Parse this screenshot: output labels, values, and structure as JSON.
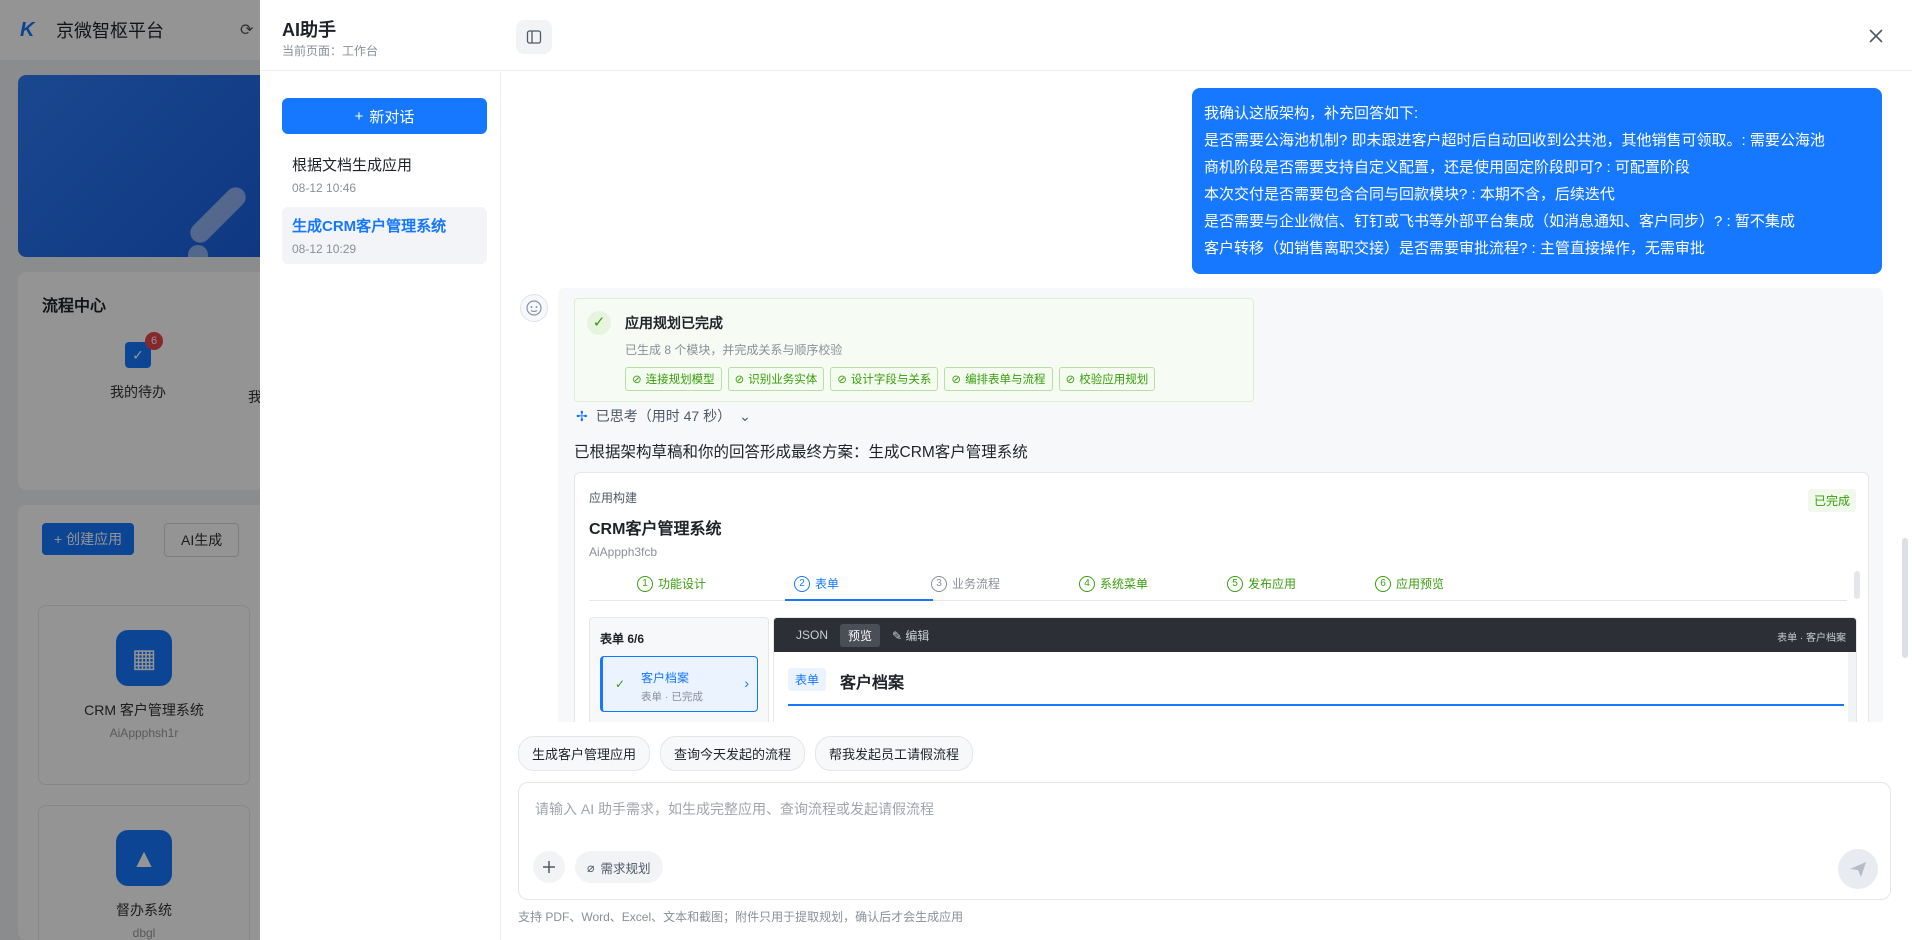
{
  "background": {
    "logo_text": "K",
    "app_title": "京微智枢平台",
    "flow_center_title": "流程中心",
    "todo_label": "我的待办",
    "todo_badge": "6",
    "todo_more_label": "我",
    "create_app_label": "+ 创建应用",
    "ai_generate_label": "AI生成",
    "apps": [
      {
        "name": "CRM 客户管理系统",
        "code": "AiAppphsh1r"
      },
      {
        "name": "督办系统",
        "code": "dbgl"
      }
    ]
  },
  "drawer": {
    "title": "AI助手",
    "subtitle": "当前页面：工作台",
    "new_chat_label": "新对话",
    "conversations": [
      {
        "title": "根据文档生成应用",
        "date": "08-12 10:46",
        "active": false
      },
      {
        "title": "生成CRM客户管理系统",
        "date": "08-12 10:29",
        "active": true
      }
    ]
  },
  "chat": {
    "user_message_lines": [
      "我确认这版架构，补充回答如下:",
      "是否需要公海池机制? 即未跟进客户超时后自动回收到公共池，其他销售可领取。: 需要公海池",
      "商机阶段是否需要支持自定义配置，还是使用固定阶段即可? : 可配置阶段",
      "本次交付是否需要包含合同与回款模块? : 本期不含，后续迭代",
      "是否需要与企业微信、钉钉或飞书等外部平台集成（如消息通知、客户同步）? : 暂不集成",
      "客户转移（如销售离职交接）是否需要审批流程? : 主管直接操作，无需审批"
    ],
    "plan": {
      "title": "应用规划已完成",
      "desc": "已生成 8 个模块，并完成关系与顺序校验",
      "tags": [
        "连接规划模型",
        "识别业务实体",
        "设计字段与关系",
        "编排表单与流程",
        "校验应用规划"
      ]
    },
    "thinking_label": "已思考（用时 47 秒）",
    "result_text": "已根据架构草稿和你的回答形成最终方案：生成CRM客户管理系统",
    "build": {
      "label": "应用构建",
      "name": "CRM客户管理系统",
      "code": "AiAppph3fcb",
      "status": "已完成",
      "steps": [
        {
          "num": "1",
          "label": "功能设计",
          "state": "done"
        },
        {
          "num": "2",
          "label": "表单",
          "state": "active"
        },
        {
          "num": "3",
          "label": "业务流程",
          "state": "pending"
        },
        {
          "num": "4",
          "label": "系统菜单",
          "state": "done"
        },
        {
          "num": "5",
          "label": "发布应用",
          "state": "done"
        },
        {
          "num": "6",
          "label": "应用预览",
          "state": "done"
        }
      ],
      "form_list_title": "表单 6/6",
      "form_item": {
        "name": "客户档案",
        "status": "表单 · 已完成"
      },
      "preview_tabs": [
        "JSON",
        "预览",
        "编辑"
      ],
      "preview_right": "表单 · 客户档案",
      "preview_form_tag": "表单",
      "preview_form_name": "客户档案"
    }
  },
  "suggestions": [
    "生成客户管理应用",
    "查询今天发起的流程",
    "帮我发起员工请假流程"
  ],
  "input": {
    "placeholder": "请输入 AI 助手需求，如生成完整应用、查询流程或发起请假流程",
    "requirement_label": "需求规划",
    "hint": "支持 PDF、Word、Excel、文本和截图；附件只用于提取规划，确认后才会生成应用"
  },
  "colors": {
    "primary": "#1677ff",
    "success": "#389e0d",
    "overlay": "rgba(0,0,0,0.42)"
  }
}
